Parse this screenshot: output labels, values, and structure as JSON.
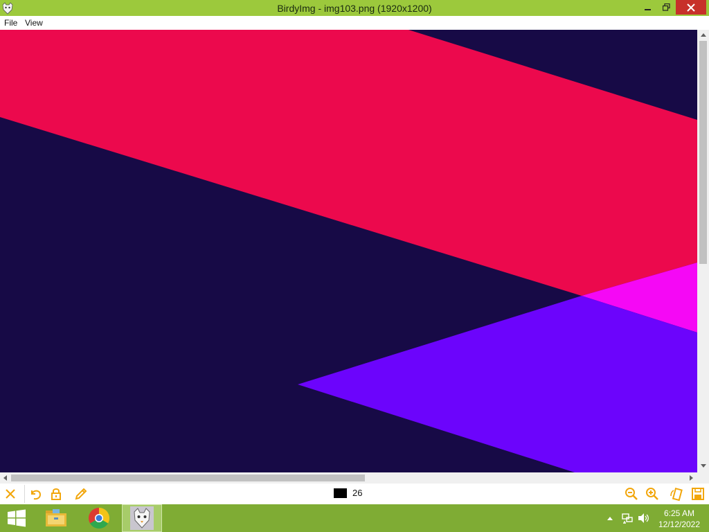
{
  "window": {
    "title": "BirdyImg - img103.png (1920x1200)",
    "icons": {
      "app": "birdyimg-app-icon",
      "minimize": "minimize-icon",
      "maximize": "restore-icon",
      "close": "close-icon"
    }
  },
  "menu": {
    "items": [
      "File",
      "View"
    ]
  },
  "viewer": {
    "image_file": "img103.png",
    "colors": {
      "background": "#170a46",
      "band": "#ec094d",
      "magenta": "#f508f5",
      "violet": "#6c04fc"
    }
  },
  "toolbar": {
    "color_swatch": "#000000",
    "color_count": "26",
    "icons": [
      "close-x-icon",
      "undo-icon",
      "lock-icon",
      "pencil-icon",
      "zoom-out-icon",
      "zoom-in-icon",
      "rotate-icon",
      "save-icon"
    ],
    "accent_color": "#f2a60b"
  },
  "taskbar": {
    "items": [
      "start-windows-icon",
      "file-explorer-icon",
      "chrome-icon",
      "birdyimg-taskbar-icon"
    ],
    "tray_icons": [
      "show-hidden-icons-icon",
      "network-icon",
      "volume-icon"
    ],
    "time": "6:25 AM",
    "date": "12/12/2022"
  }
}
